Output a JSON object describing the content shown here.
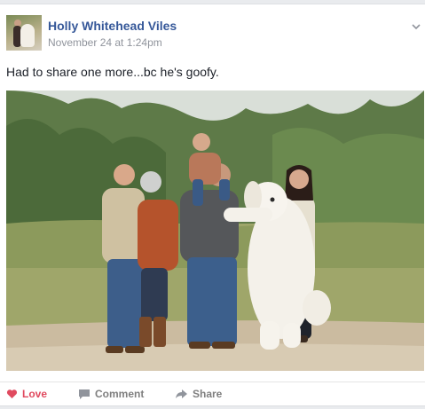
{
  "post": {
    "author": "Holly Whitehead Viles",
    "timestamp": "November 24 at 1:24pm",
    "text": "Had to share one more...bc he's goofy."
  },
  "actions": {
    "love": "Love",
    "comment": "Comment",
    "share": "Share"
  },
  "icons": {
    "love": "heart-icon",
    "comment": "comment-bubble-icon",
    "share": "share-arrow-icon",
    "menu": "chevron-down-icon"
  },
  "colors": {
    "author_link": "#365899",
    "love_active": "#e04a5f",
    "action_gray": "#7f7f7f",
    "meta_gray": "#90949c"
  }
}
